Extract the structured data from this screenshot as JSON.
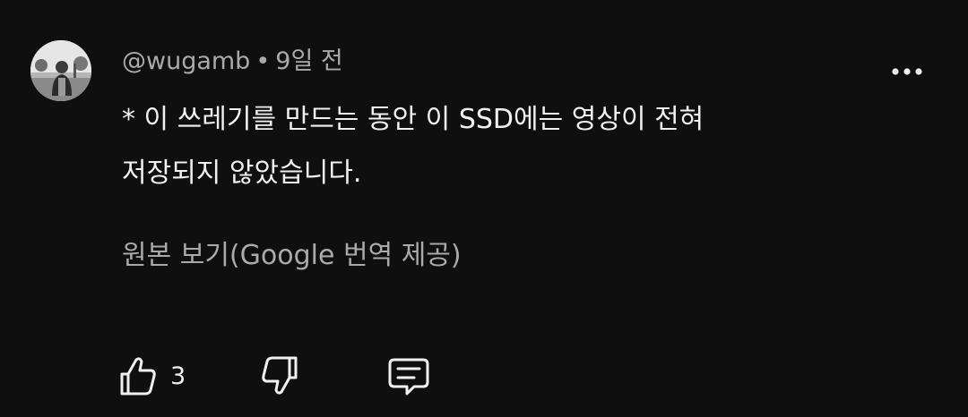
{
  "comment": {
    "author": "@wugamb",
    "separator": "•",
    "time": "9일 전",
    "text_line1": "* 이 쓰레기를 만드는 동안 이 SSD에는 영상이 전혀",
    "text_line2": "저장되지 않았습니다.",
    "translate_link": "원본 보기(Google 번역 제공)",
    "like_count": "3"
  },
  "icons": {
    "avatar": "avatar-photo",
    "more": "more-dots-icon",
    "like": "thumb-up-icon",
    "dislike": "thumb-down-icon",
    "reply": "reply-comment-icon"
  },
  "colors": {
    "background": "#0f0f0f",
    "primary_text": "#f1f1f1",
    "secondary_text": "#aaaaaa"
  }
}
